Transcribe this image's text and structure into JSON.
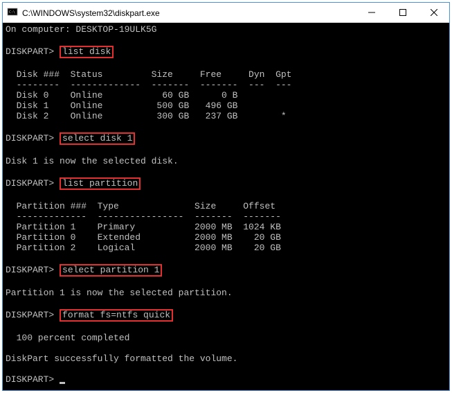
{
  "window": {
    "title": "C:\\WINDOWS\\system32\\diskpart.exe"
  },
  "lines": {
    "computer": "On computer: DESKTOP-19ULK5G",
    "prompt": "DISKPART>",
    "cmd1": "list disk",
    "disk_header": "  Disk ###  Status         Size     Free     Dyn  Gpt",
    "disk_sep": "  --------  -------------  -------  -------  ---  ---",
    "disk0": "  Disk 0    Online           60 GB      0 B",
    "disk1": "  Disk 1    Online          500 GB   496 GB",
    "disk2": "  Disk 2    Online          300 GB   237 GB        *",
    "cmd2": "select disk 1",
    "msg_sel_disk": "Disk 1 is now the selected disk.",
    "cmd3": "list partition",
    "part_header": "  Partition ###  Type              Size     Offset",
    "part_sep": "  -------------  ----------------  -------  -------",
    "part1": "  Partition 1    Primary           2000 MB  1024 KB",
    "part0": "  Partition 0    Extended          2000 MB    20 GB",
    "part2": "  Partition 2    Logical           2000 MB    20 GB",
    "cmd4": "select partition 1",
    "msg_sel_part": "Partition 1 is now the selected partition.",
    "cmd5": "format fs=ntfs quick",
    "msg_progress": "  100 percent completed",
    "msg_done": "DiskPart successfully formatted the volume."
  }
}
